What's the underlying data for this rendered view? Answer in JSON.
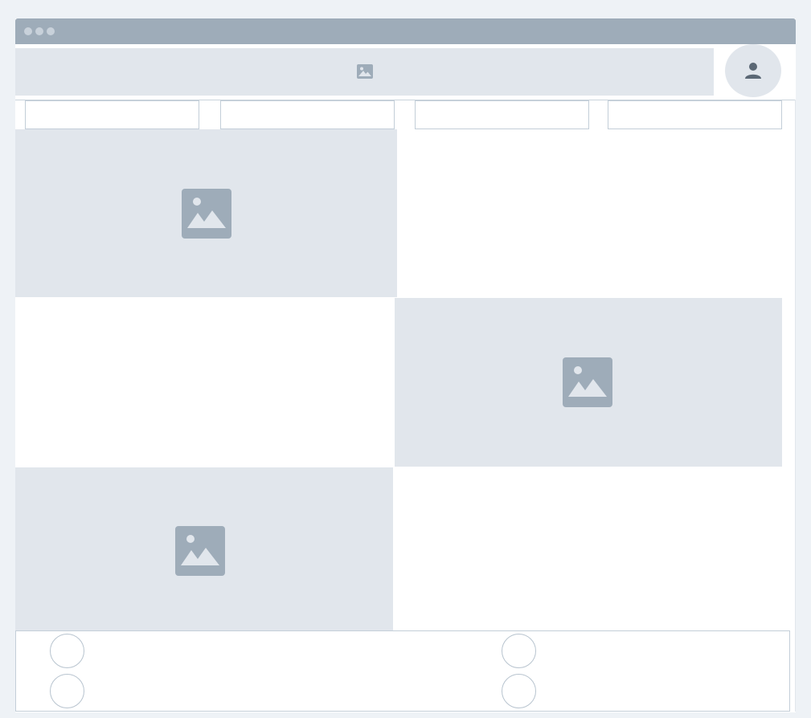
{
  "colors": {
    "page_background": "#eef2f6",
    "titlebar": "#9eacb9",
    "placeholder_fill": "#e1e6ec",
    "icon": "#9eacb9",
    "border": "#c3ced8"
  },
  "titlebar": {
    "window_controls": [
      "dot",
      "dot",
      "dot"
    ]
  },
  "header": {
    "banner_icon": "image-placeholder-icon",
    "avatar_icon": "user-icon"
  },
  "tabs": [
    {
      "label": ""
    },
    {
      "label": ""
    },
    {
      "label": ""
    },
    {
      "label": ""
    }
  ],
  "content": {
    "rows": [
      {
        "image_side": "left",
        "icon": "image-placeholder-icon"
      },
      {
        "image_side": "right",
        "icon": "image-placeholder-icon"
      },
      {
        "image_side": "left",
        "icon": "image-placeholder-icon"
      }
    ]
  },
  "footer": {
    "radio_options": [
      {
        "label": "",
        "selected": false
      },
      {
        "label": "",
        "selected": false
      },
      {
        "label": "",
        "selected": false
      },
      {
        "label": "",
        "selected": false
      }
    ]
  }
}
